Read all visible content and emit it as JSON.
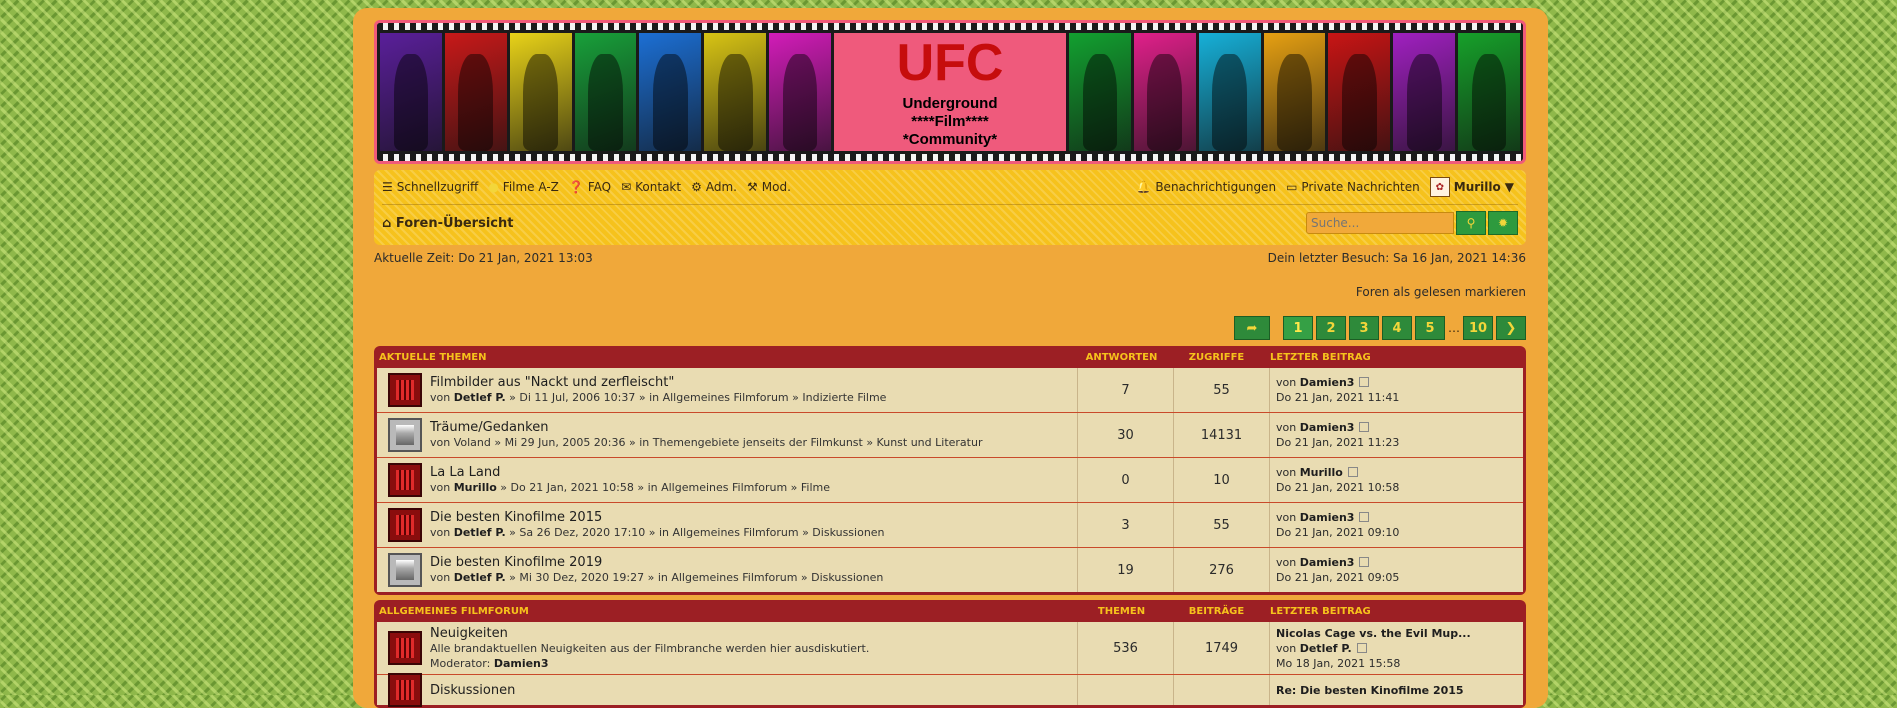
{
  "banner": {
    "logo": "UFC",
    "subtitle_lines": [
      "Underground",
      "****Film****",
      "*Community*"
    ],
    "left_frame_colors": [
      "#5a1f9a",
      "#c81919",
      "#e8d218",
      "#18a03a",
      "#1c6fd4",
      "#d8c414",
      "#d21cb8"
    ],
    "right_frame_colors": [
      "#12a030",
      "#e0208a",
      "#16b0d8",
      "#e6a012",
      "#c81515",
      "#a020c0",
      "#16a02a"
    ]
  },
  "nav": {
    "schnellzugriff": "Schnellzugriff",
    "filme": "Filme A-Z",
    "faq": "FAQ",
    "kontakt": "Kontakt",
    "adm": "Adm.",
    "mod": "Mod.",
    "benachrichtigungen": "Benachrichtigungen",
    "pn": "Private Nachrichten",
    "user": "Murillo",
    "breadcrumb": "Foren-Übersicht",
    "search_placeholder": "Suche..."
  },
  "info": {
    "current_time": "Aktuelle Zeit: Do 21 Jan, 2021 13:03",
    "last_visit": "Dein letzter Besuch: Sa 16 Jan, 2021 14:36",
    "mark_read": "Foren als gelesen markieren"
  },
  "pagination": {
    "pages": [
      "1",
      "2",
      "3",
      "4",
      "5"
    ],
    "ellipsis": "…",
    "last": "10",
    "current": "1"
  },
  "active_topics": {
    "header": {
      "title": "Aktuelle Themen",
      "replies": "Antworten",
      "views": "Zugriffe",
      "last": "Letzter Beitrag"
    },
    "rows": [
      {
        "icon": "red",
        "title": "Filmbilder aus \"Nackt und zerfleischt\"",
        "by": "von",
        "author": "Detlef P.",
        "author_bold": true,
        "meta": "» Di 11 Jul, 2006 10:37 » in Allgemeines Filmforum » Indizierte Filme",
        "replies": "7",
        "views": "55",
        "last_by": "Damien3",
        "last_date": "Do 21 Jan, 2021 11:41"
      },
      {
        "icon": "grey",
        "title": "Träume/Gedanken",
        "by": "von",
        "author": "Voland",
        "author_bold": false,
        "meta": "» Mi 29 Jun, 2005 20:36 » in Themengebiete jenseits der Filmkunst » Kunst und Literatur",
        "replies": "30",
        "views": "14131",
        "last_by": "Damien3",
        "last_date": "Do 21 Jan, 2021 11:23"
      },
      {
        "icon": "red",
        "title": "La La Land",
        "by": "von",
        "author": "Murillo",
        "author_bold": true,
        "meta": "» Do 21 Jan, 2021 10:58 » in Allgemeines Filmforum » Filme",
        "replies": "0",
        "views": "10",
        "last_by": "Murillo",
        "last_date": "Do 21 Jan, 2021 10:58"
      },
      {
        "icon": "red",
        "title": "Die besten Kinofilme 2015",
        "by": "von",
        "author": "Detlef P.",
        "author_bold": true,
        "meta": "» Sa 26 Dez, 2020 17:10 » in Allgemeines Filmforum » Diskussionen",
        "replies": "3",
        "views": "55",
        "last_by": "Damien3",
        "last_date": "Do 21 Jan, 2021 09:10"
      },
      {
        "icon": "grey",
        "title": "Die besten Kinofilme 2019",
        "by": "von",
        "author": "Detlef P.",
        "author_bold": true,
        "meta": "» Mi 30 Dez, 2020 19:27 » in Allgemeines Filmforum » Diskussionen",
        "replies": "19",
        "views": "276",
        "last_by": "Damien3",
        "last_date": "Do 21 Jan, 2021 09:05"
      }
    ]
  },
  "general_forum": {
    "header": {
      "title": "Allgemeines Filmforum",
      "topics": "Themen",
      "posts": "Beiträge",
      "last": "Letzter Beitrag"
    },
    "rows": [
      {
        "title": "Neuigkeiten",
        "desc": "Alle brandaktuellen Neuigkeiten aus der Filmbranche werden hier ausdiskutiert.",
        "mod_label": "Moderator:",
        "mod_name": "Damien3",
        "topics": "536",
        "posts": "1749",
        "last_topic": "Nicolas Cage vs. the Evil Mup...",
        "by": "von",
        "last_by": "Detlef P.",
        "last_date": "Mo 18 Jan, 2021 15:58"
      },
      {
        "title": "Diskussionen",
        "last_topic": "Re: Die besten Kinofilme 2015"
      }
    ]
  }
}
